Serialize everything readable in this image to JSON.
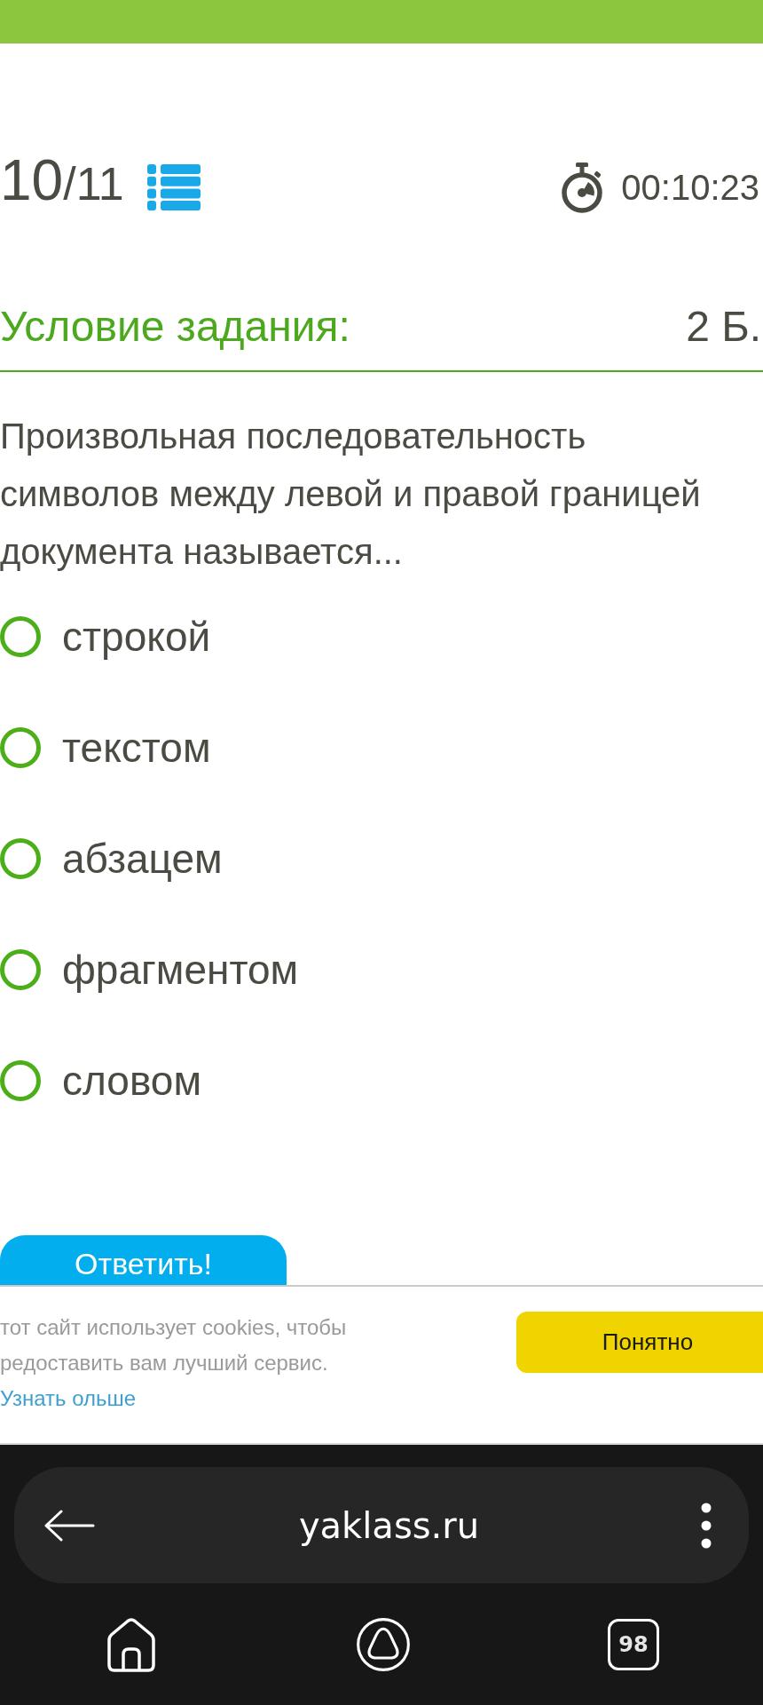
{
  "counter": {
    "current": "10",
    "of_total": "/11"
  },
  "timer": {
    "time": "00:10:23"
  },
  "task": {
    "heading": "Условие задания:",
    "points": "2 Б."
  },
  "question": {
    "text": "Произвольная последовательность символов между левой и правой границей документа называется...",
    "options": [
      {
        "label": "строкой",
        "selected": false
      },
      {
        "label": "текстом",
        "selected": false
      },
      {
        "label": "абзацем",
        "selected": false
      },
      {
        "label": "фрагментом",
        "selected": false
      },
      {
        "label": "словом",
        "selected": false
      }
    ]
  },
  "submit_button": {
    "label": "Ответить!"
  },
  "cookie_notice": {
    "text": "тот сайт использует cookies, чтобы редоставить вам лучший сервис.",
    "link": "Узнать ольше",
    "button": "Понятно"
  },
  "browser": {
    "url": "yaklass.ru",
    "tab_count": "98"
  }
}
